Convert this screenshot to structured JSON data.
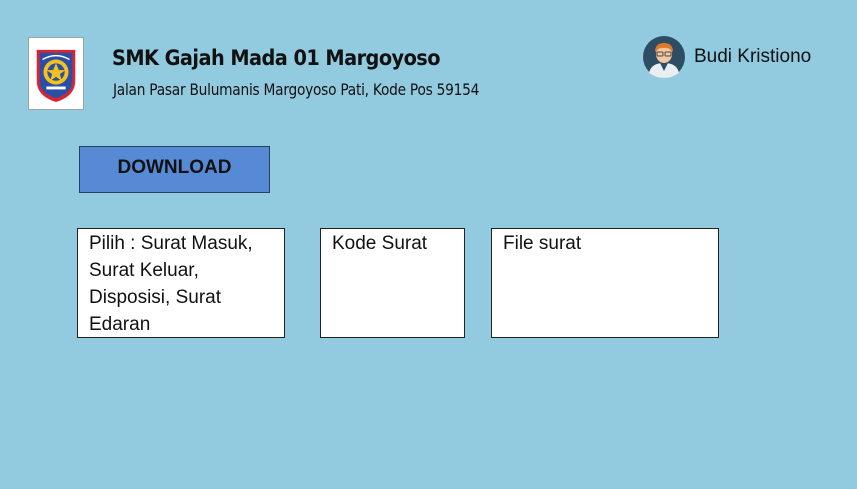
{
  "header": {
    "logo_icon": "school-crest-icon",
    "school_name": "SMK Gajah Mada 01 Margoyoso",
    "school_address": "Jalan Pasar Bulumanis Margoyoso Pati, Kode Pos 59154"
  },
  "user": {
    "avatar_icon": "user-avatar-icon",
    "name": "Budi Kristiono"
  },
  "actions": {
    "download_label": "DOWNLOAD"
  },
  "fields": {
    "pilih_label": "Pilih : Surat Masuk, Surat Keluar, Disposisi, Surat Edaran",
    "kode_label": "Kode Surat",
    "file_label": "File surat"
  },
  "colors": {
    "background": "#92cbdf",
    "download_button": "#568ad5"
  }
}
